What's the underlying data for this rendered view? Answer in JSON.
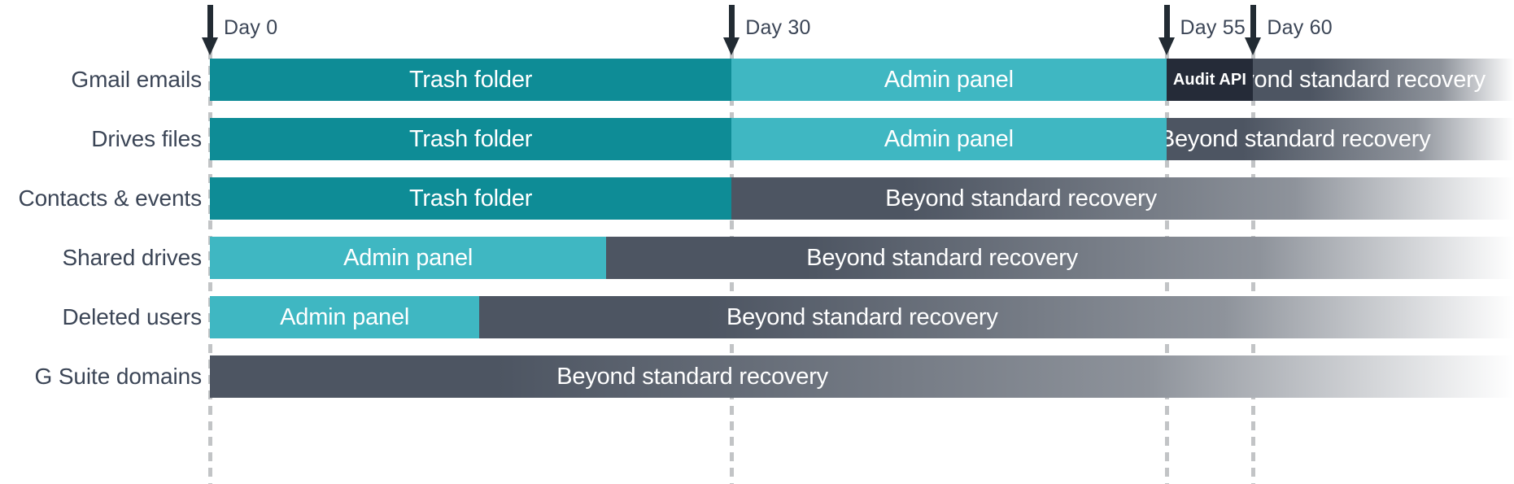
{
  "chart_data": {
    "type": "bar",
    "title": "",
    "subtitle": "",
    "xlabel": "",
    "ylabel": "",
    "orientation": "horizontal-stacked-timeline",
    "xlim": [
      0,
      75
    ],
    "grid": true,
    "legend": "none",
    "axis_ticks": [
      {
        "label": "Day 0",
        "day": 0
      },
      {
        "label": "Day 30",
        "day": 30
      },
      {
        "label": "Day 55",
        "day": 55
      },
      {
        "label": "Day 60",
        "day": 60
      }
    ],
    "categories": [
      "Gmail emails",
      "Drives files",
      "Contacts & events",
      "Shared drives",
      "Deleted users",
      "G Suite domains"
    ],
    "rows": [
      {
        "label": "Gmail emails",
        "segments": [
          {
            "text": "Trash folder",
            "start": 0,
            "end": 30,
            "color": "#0e8c96",
            "style": "solid"
          },
          {
            "text": "Admin panel",
            "start": 30,
            "end": 55,
            "color": "#3fb7c2",
            "style": "solid"
          },
          {
            "text": "Audit API",
            "start": 55,
            "end": 60,
            "color": "#252b38",
            "style": "solid"
          },
          {
            "text": "Beyond standard recovery",
            "start": 60,
            "end": 75,
            "color": "#4d5562",
            "style": "fade"
          }
        ]
      },
      {
        "label": "Drives files",
        "segments": [
          {
            "text": "Trash folder",
            "start": 0,
            "end": 30,
            "color": "#0e8c96",
            "style": "solid"
          },
          {
            "text": "Admin panel",
            "start": 30,
            "end": 55,
            "color": "#3fb7c2",
            "style": "solid"
          },
          {
            "text": "Beyond standard recovery",
            "start": 55,
            "end": 75,
            "color": "#4d5562",
            "style": "fade"
          }
        ]
      },
      {
        "label": "Contacts & events",
        "segments": [
          {
            "text": "Trash folder",
            "start": 0,
            "end": 30,
            "color": "#0e8c96",
            "style": "solid"
          },
          {
            "text": "Beyond standard recovery",
            "start": 30,
            "end": 75,
            "color": "#4d5562",
            "style": "fade"
          }
        ]
      },
      {
        "label": "Shared drives",
        "segments": [
          {
            "text": "Admin panel",
            "start": 0,
            "end": 22.8,
            "color": "#3fb7c2",
            "style": "solid"
          },
          {
            "text": "Beyond standard recovery",
            "start": 22.8,
            "end": 75,
            "color": "#4d5562",
            "style": "fade"
          }
        ]
      },
      {
        "label": "Deleted users",
        "segments": [
          {
            "text": "Admin panel",
            "start": 0,
            "end": 15.5,
            "color": "#3fb7c2",
            "style": "solid"
          },
          {
            "text": "Beyond standard recovery",
            "start": 15.5,
            "end": 75,
            "color": "#4d5562",
            "style": "fade"
          }
        ]
      },
      {
        "label": "G Suite domains",
        "segments": [
          {
            "text": "Beyond standard recovery",
            "start": 0,
            "end": 75,
            "color": "#4d5562",
            "style": "fade"
          }
        ]
      }
    ],
    "colors": {
      "trash_folder": "#0e8c96",
      "admin_panel": "#3fb7c2",
      "audit_api": "#252b38",
      "beyond_recovery": "#4d5562",
      "text_dark": "#3b4556",
      "gridline": "#c2c4c6",
      "arrow": "#222b33",
      "background": "#ffffff"
    }
  }
}
